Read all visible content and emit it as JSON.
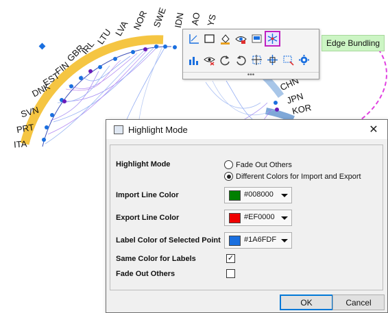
{
  "chart": {
    "labels_left": [
      "SWE",
      "NOR",
      "LVA",
      "LTU",
      "IRL",
      "GBR",
      "FIN",
      "EST",
      "DNK",
      "SVN",
      "PRT",
      "ITA"
    ],
    "labels_top": [
      "IDN",
      "AO",
      "YS"
    ],
    "labels_right": [
      "CHN",
      "JPN",
      "KOR"
    ]
  },
  "toolbar": {
    "tooltip": "Edge Bundling",
    "grip": "•••",
    "row1_icons": [
      "axis-icon",
      "rectangle-icon",
      "fill-icon",
      "eye-icon",
      "label-box-icon",
      "edge-bundling-icon"
    ],
    "row2_icons": [
      "bar-chart-icon",
      "hide-icon",
      "rotate-left-icon",
      "rotate-right-icon",
      "resize-icon",
      "move-icon",
      "select-icon",
      "settings-icon"
    ]
  },
  "dialog": {
    "title": "Highlight Mode",
    "close": "✕",
    "highlight_mode_label": "Highlight Mode",
    "option_fade": "Fade Out Others",
    "option_diff": "Different Colors for Import and Export",
    "import_label": "Import Line Color",
    "import_value": "#008000",
    "export_label": "Export Line Color",
    "export_value": "#EF0000",
    "label_color_label": "Label Color of Selected Point",
    "label_color_value": "#1A6FDF",
    "same_color_label": "Same Color for Labels",
    "same_color_check": "✓",
    "fade_out_label": "Fade Out Others",
    "ok": "OK",
    "cancel": "Cancel"
  },
  "colors": {
    "import_swatch": "#008000",
    "export_swatch": "#EF0000",
    "label_swatch": "#1A6FDF",
    "ring": "#F5C542",
    "accent": "#E040E0"
  }
}
